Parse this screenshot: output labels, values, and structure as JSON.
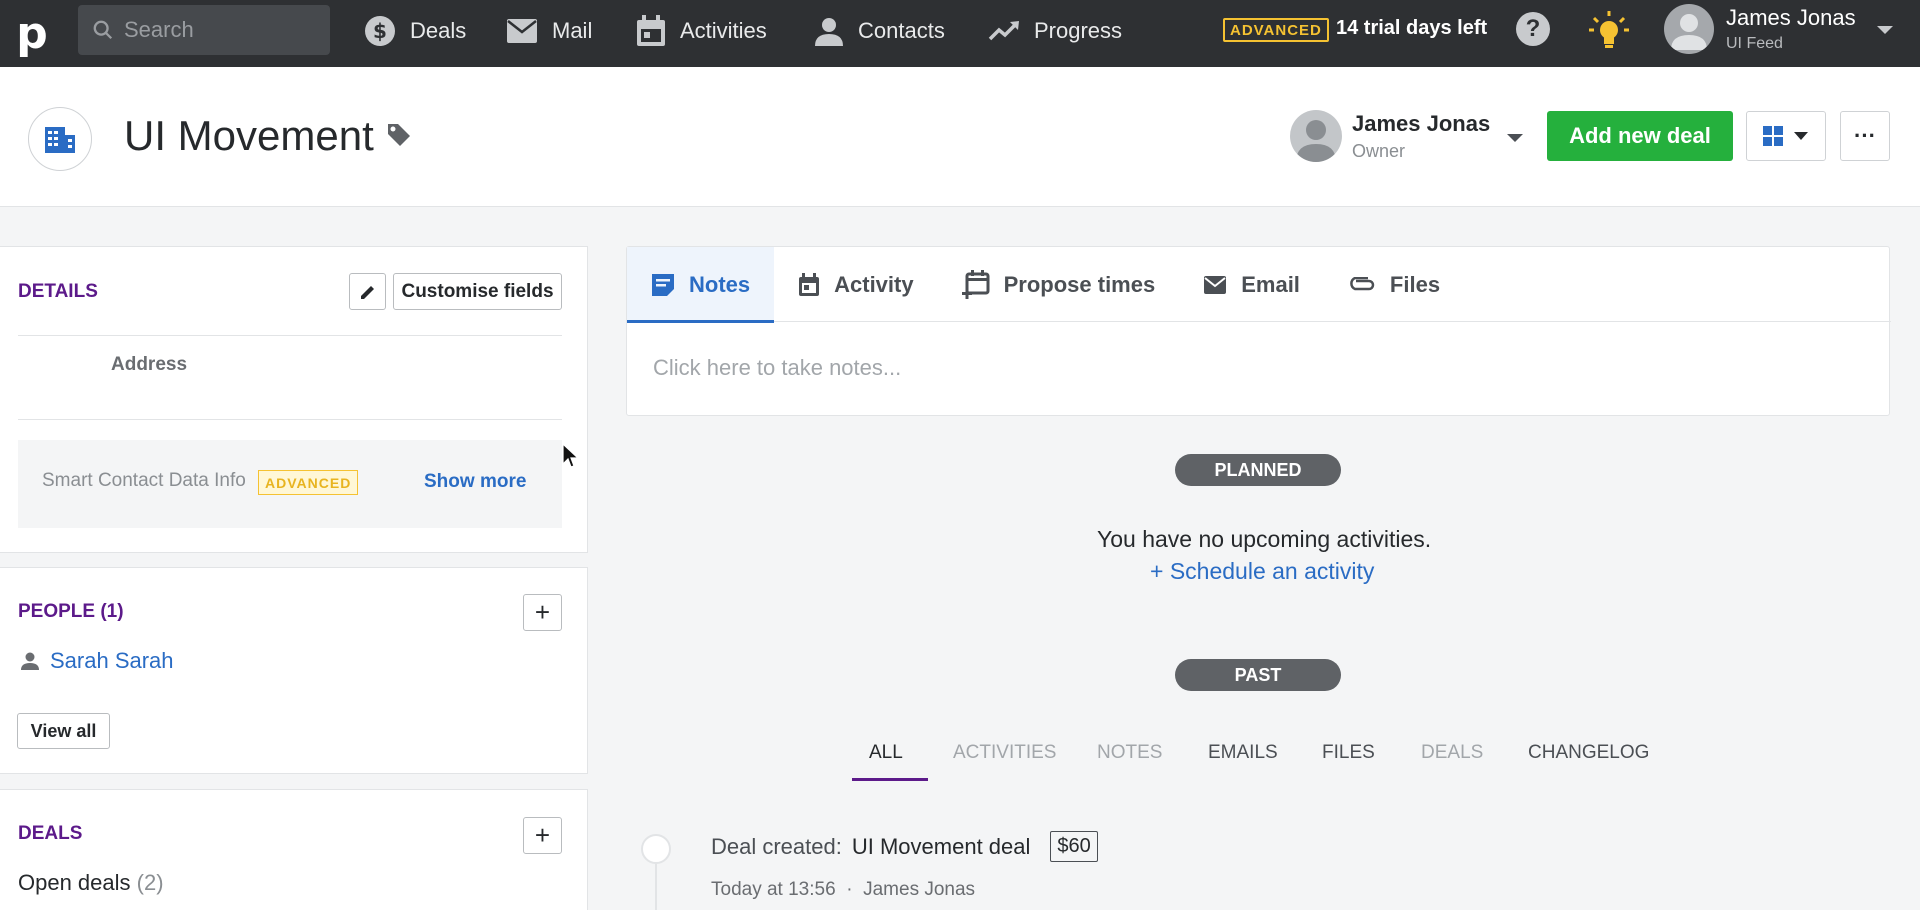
{
  "nav": {
    "search_placeholder": "Search",
    "items": [
      {
        "label": "Deals",
        "icon": "dollar-icon"
      },
      {
        "label": "Mail",
        "icon": "mail-icon"
      },
      {
        "label": "Activities",
        "icon": "calendar-icon"
      },
      {
        "label": "Contacts",
        "icon": "person-icon"
      },
      {
        "label": "Progress",
        "icon": "trending-icon"
      }
    ],
    "plan_badge": "ADVANCED",
    "trial_text": "14 trial days left",
    "user_name": "James Jonas",
    "user_company": "UI Feed"
  },
  "header": {
    "title": "UI Movement",
    "owner_name": "James Jonas",
    "owner_role": "Owner",
    "add_deal_label": "Add new deal",
    "more_label": "···"
  },
  "details": {
    "title": "DETAILS",
    "customise_label": "Customise fields",
    "address_label": "Address",
    "smart_label": "Smart Contact Data Info",
    "smart_badge": "ADVANCED",
    "show_more": "Show more"
  },
  "people": {
    "title": "PEOPLE (1)",
    "person": "Sarah Sarah",
    "view_all": "View all"
  },
  "deals": {
    "title": "DEALS",
    "open_label": "Open deals",
    "open_count": "(2)"
  },
  "tabs": [
    {
      "label": "Notes",
      "icon": "note-icon"
    },
    {
      "label": "Activity",
      "icon": "calendar-icon"
    },
    {
      "label": "Propose times",
      "icon": "calendar-plus-icon"
    },
    {
      "label": "Email",
      "icon": "mail-icon"
    },
    {
      "label": "Files",
      "icon": "paperclip-icon"
    }
  ],
  "notes_placeholder": "Click here to take notes...",
  "planned": {
    "pill": "PLANNED",
    "empty": "You have no upcoming activities.",
    "schedule": "+ Schedule an activity"
  },
  "past": {
    "pill": "PAST",
    "filters": [
      "ALL",
      "ACTIVITIES",
      "NOTES",
      "EMAILS",
      "FILES",
      "DEALS",
      "CHANGELOG"
    ]
  },
  "feed": {
    "label": "Deal created:",
    "deal_name": "UI Movement deal",
    "amount": "$60",
    "time": "Today at 13:56",
    "sep": "·",
    "author": "James Jonas"
  },
  "colors": {
    "brand_green": "#25b03d",
    "link_blue": "#2a6cc4",
    "section_purple": "#5c1a8a",
    "advanced_yellow": "#f5c232"
  }
}
